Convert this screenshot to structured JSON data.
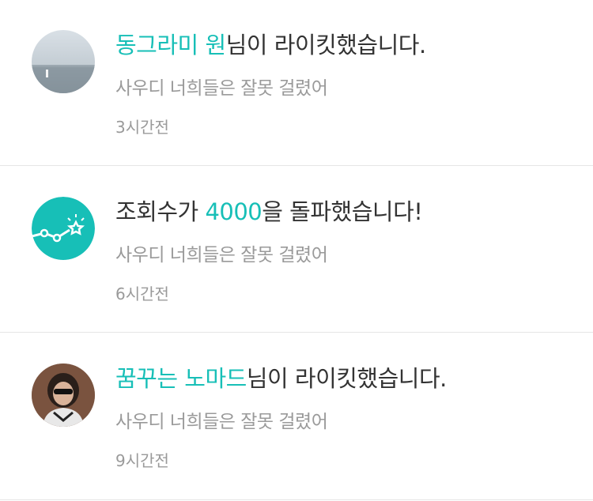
{
  "notifications": [
    {
      "type": "like",
      "user": "동그라미 원",
      "suffix": "님이 라이킷했습니다.",
      "post_title": "사우디 너희들은 잘못 걸렸어",
      "time": "3시간전",
      "avatar_icon": "sea-photo-avatar"
    },
    {
      "type": "milestone",
      "prefix": "조회수가 ",
      "count": "4000",
      "suffix": "을 돌파했습니다!",
      "post_title": "사우디 너희들은 잘못 걸렸어",
      "time": "6시간전",
      "avatar_icon": "stats-star-icon",
      "accent": "#17bfb7"
    },
    {
      "type": "like",
      "user": "꿈꾸는 노마드",
      "suffix": "님이 라이킷했습니다.",
      "post_title": "사우디 너희들은 잘못 걸렸어",
      "time": "9시간전",
      "avatar_icon": "person-photo-avatar"
    }
  ],
  "colors": {
    "accent": "#17bfb7",
    "text": "#333333",
    "muted": "#9a9a9a"
  }
}
